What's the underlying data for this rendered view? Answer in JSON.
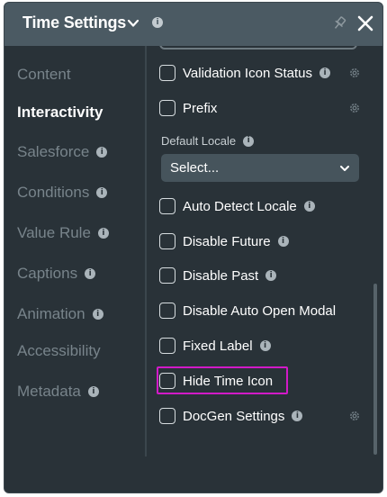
{
  "header": {
    "title": "Time Settings",
    "info_glyph": "i"
  },
  "nav": {
    "items": [
      {
        "label": "Content",
        "info": false
      },
      {
        "label": "Interactivity",
        "info": false,
        "active": true
      },
      {
        "label": "Salesforce",
        "info": true
      },
      {
        "label": "Conditions",
        "info": true
      },
      {
        "label": "Value Rule",
        "info": true
      },
      {
        "label": "Captions",
        "info": true
      },
      {
        "label": "Animation",
        "info": true
      },
      {
        "label": "Accessibility",
        "info": false
      },
      {
        "label": "Metadata",
        "info": true
      }
    ]
  },
  "settings": {
    "validation_icon_status": "Validation Icon Status",
    "prefix": "Prefix",
    "default_locale_label": "Default Locale",
    "default_locale_value": "Select...",
    "auto_detect_locale": "Auto Detect Locale",
    "disable_future": "Disable Future",
    "disable_past": "Disable Past",
    "disable_auto_open_modal": "Disable Auto Open Modal",
    "fixed_label": "Fixed Label",
    "hide_time_icon": "Hide Time Icon",
    "docgen_settings": "DocGen Settings"
  },
  "colors": {
    "panel_bg": "#293238",
    "header_bg": "#4b5a63",
    "highlight": "#d21ac8"
  },
  "icons": [
    "chevron-down-icon",
    "info-icon",
    "pin-icon",
    "close-icon",
    "gear-icon"
  ]
}
